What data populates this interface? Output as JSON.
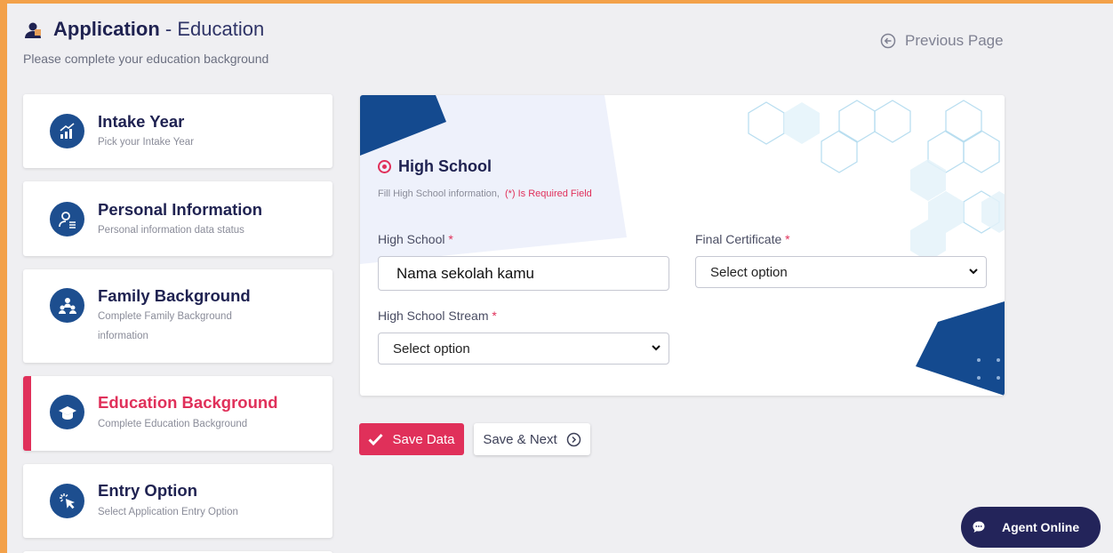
{
  "header": {
    "title": "Application",
    "title_suffix": "- Education",
    "subtitle": "Please complete your education background",
    "previous_page": "Previous Page"
  },
  "sidebar": {
    "items": [
      {
        "title": "Intake Year",
        "desc": "Pick your Intake Year",
        "icon": "chart-icon"
      },
      {
        "title": "Personal Information",
        "desc": "Personal information data status",
        "icon": "user-card-icon"
      },
      {
        "title": "Family Background",
        "desc": "Complete Family Background information",
        "icon": "family-icon"
      },
      {
        "title": "Education Background",
        "desc": "Complete Education Background",
        "icon": "graduation-cap-icon",
        "active": true
      },
      {
        "title": "Entry Option",
        "desc": "Select Application Entry Option",
        "icon": "cursor-click-icon"
      }
    ]
  },
  "form": {
    "section_title": "High School",
    "section_subtitle": "Fill High School information,",
    "required_note": "(*) Is Required Field",
    "high_school_label": "High School",
    "high_school_value": "Nama sekolah kamu",
    "final_certificate_label": "Final Certificate",
    "final_certificate_value": "Select option",
    "stream_label": "High School Stream",
    "stream_value": "Select option",
    "required_mark": "*"
  },
  "buttons": {
    "save": "Save Data",
    "save_next": "Save & Next"
  },
  "chat": {
    "label": "Agent Online"
  },
  "colors": {
    "accent": "#e0305a",
    "navy": "#1f2251",
    "icon_blue": "#1d4e8f",
    "frame_border": "#f3a14a"
  }
}
